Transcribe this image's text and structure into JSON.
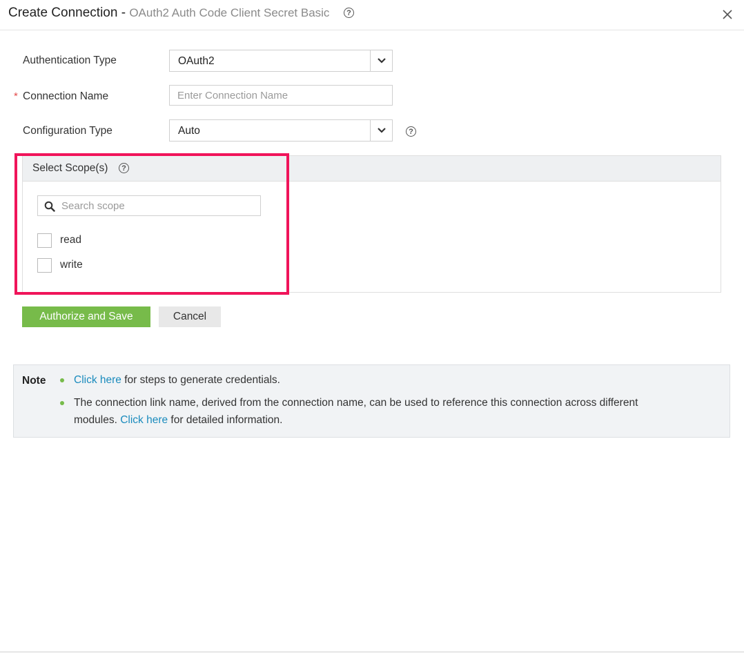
{
  "dialog": {
    "title": "Create Connection -",
    "subtitle": "OAuth2 Auth Code Client Secret Basic"
  },
  "form": {
    "auth_type_label": "Authentication Type",
    "auth_type_value": "OAuth2",
    "required_mark": "*",
    "connection_name_label": "Connection Name",
    "connection_name_value": "",
    "connection_name_placeholder": "Enter Connection Name",
    "config_type_label": "Configuration Type",
    "config_type_value": "Auto"
  },
  "scopes": {
    "title": "Select Scope(s)",
    "search_placeholder": "Search scope",
    "items": [
      {
        "label": "read",
        "checked": false
      },
      {
        "label": "write",
        "checked": false
      }
    ]
  },
  "actions": {
    "authorize_label": "Authorize and Save",
    "cancel_label": "Cancel"
  },
  "note": {
    "label": "Note",
    "line1_link": "Click here",
    "line1_text": " for steps to generate credentials.",
    "line2_text": "The connection link name, derived from the connection name, can be used to reference this connection across different",
    "line3_prefix": "modules. ",
    "line3_link": "Click here",
    "line3_text": " for detailed information."
  },
  "icons": {
    "help": "help-icon",
    "close": "close-icon",
    "dropdown": "chevron-down-icon",
    "search": "search-icon"
  },
  "colors": {
    "primary_button": "#77bb4a",
    "highlight": "#f0145a",
    "link": "#1a8bbd",
    "required": "#e34b4b"
  }
}
